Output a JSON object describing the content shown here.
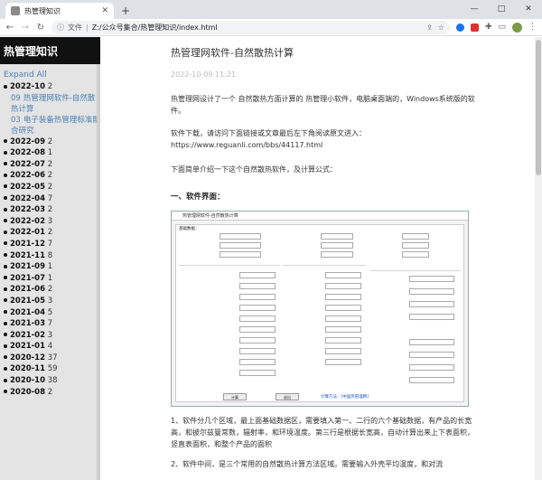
{
  "browser": {
    "tab_title": "热管理知识",
    "new_tab": "+",
    "address_label": "文件",
    "address_path": "Z:/公众号集合/热管理知识/index.html",
    "window_controls": [
      "—",
      "□",
      "✕"
    ]
  },
  "sidebar": {
    "title": "热管理知识",
    "expand_all": "Expand All",
    "items": [
      {
        "year": "2022-10",
        "count": "2",
        "subitems": [
          {
            "num": "09",
            "label": "热管理网软件-自然散热计算"
          },
          {
            "num": "03",
            "label": "电子装备热管理标准融合研究"
          }
        ]
      },
      {
        "year": "2022-09",
        "count": "2"
      },
      {
        "year": "2022-08",
        "count": "1"
      },
      {
        "year": "2022-07",
        "count": "2"
      },
      {
        "year": "2022-06",
        "count": "2"
      },
      {
        "year": "2022-05",
        "count": "2"
      },
      {
        "year": "2022-04",
        "count": "7"
      },
      {
        "year": "2022-03",
        "count": "2"
      },
      {
        "year": "2022-02",
        "count": "3"
      },
      {
        "year": "2022-01",
        "count": "2"
      },
      {
        "year": "2021-12",
        "count": "7"
      },
      {
        "year": "2021-11",
        "count": "8"
      },
      {
        "year": "2021-09",
        "count": "1"
      },
      {
        "year": "2021-07",
        "count": "1"
      },
      {
        "year": "2021-06",
        "count": "2"
      },
      {
        "year": "2021-05",
        "count": "3"
      },
      {
        "year": "2021-04",
        "count": "5"
      },
      {
        "year": "2021-03",
        "count": "7"
      },
      {
        "year": "2021-02",
        "count": "3"
      },
      {
        "year": "2021-01",
        "count": "4"
      },
      {
        "year": "2020-12",
        "count": "37"
      },
      {
        "year": "2020-11",
        "count": "59"
      },
      {
        "year": "2020-10",
        "count": "38"
      },
      {
        "year": "2020-08",
        "count": "2"
      }
    ]
  },
  "article": {
    "title": "热管理网软件-自然散热计算",
    "date": "2022-10-09 11:21",
    "intro": "热管理网设计了一个 自然散热方面计算的 热管理小软件，电脑桌面端的，Windows系统版的软件。",
    "download_text": "软件下载，请访问下面链接或文章最后左下角阅读原文进入：",
    "download_url": "https://www.reguanli.com/bbs/44117.html",
    "section_intro": "下面简单介绍一下这个自然散热软件，及计算公式：",
    "section_heading": "一、软件界面：",
    "screenshot": {
      "window_title": "热管理网软件-自然散热计算",
      "group_basic": "基础数据：",
      "btn_calc": "计算",
      "btn_exit": "退出",
      "link": "计算方法：[中国热管理网]"
    },
    "paragraph1": "1、软件分几个区域，最上面基础数据区，需要填入第一、二行的六个基础数据，有产品的长宽高，和披尔兹曼常数，辐射率，和环境温度。第三行是根据长宽高，自动计算出来上下表面积，竖直表面积，和整个产品的面积",
    "paragraph2": "2、软件中间，是三个常用的自然散热计算方法区域。需要输入外壳平均温度，和对流"
  }
}
